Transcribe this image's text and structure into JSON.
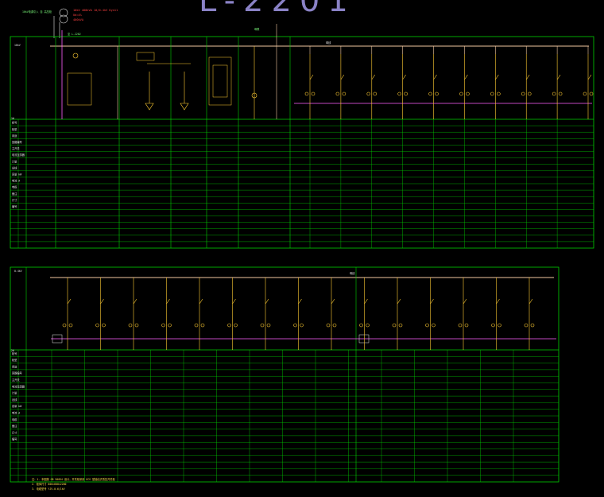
{
  "drawing_title": "L-2201",
  "annotations": {
    "red_note_1": "10kV 400kVA 10/0.4kV Dyn11",
    "red_note_2": "Ud=4%",
    "red_note_3": "400kVA",
    "source_label": "10kV电源引入 自 高压柜",
    "tie_label_1": "母联",
    "tie_label_2": "至 L-2202",
    "bus_label_top": "母线",
    "bus_label_bottom": "母线",
    "top_left_box": "10kV",
    "bottom_left_box": "0.4kV"
  },
  "row_labels": [
    "柜号",
    "柜型",
    "用途",
    "回路编号",
    "主开关",
    "电流互感器",
    "计量",
    "出线",
    "容量 kW",
    "电流 A",
    "电缆",
    "备注",
    "尺寸",
    "编号"
  ],
  "footer_notes": [
    "注：1. 本图按 GB 50054 设计，开关柜采用 GCS 型抽出式低压开关柜",
    "2. 柜体尺寸 800×600×2200",
    "3. 电缆型号 YJV-0.6/1kV"
  ],
  "colors": {
    "frame": "#00d000",
    "bus": "#ff60ff",
    "circuit": "#ffcc33",
    "wire": "#f2c9a0",
    "red": "#ff4040",
    "text": "#e6e6e6",
    "title": "#8a82c6"
  },
  "panel_top": {
    "feeders": 9,
    "bus_label": "母线"
  },
  "panel_bottom": {
    "feeders": 15,
    "bus_label": "母线"
  }
}
